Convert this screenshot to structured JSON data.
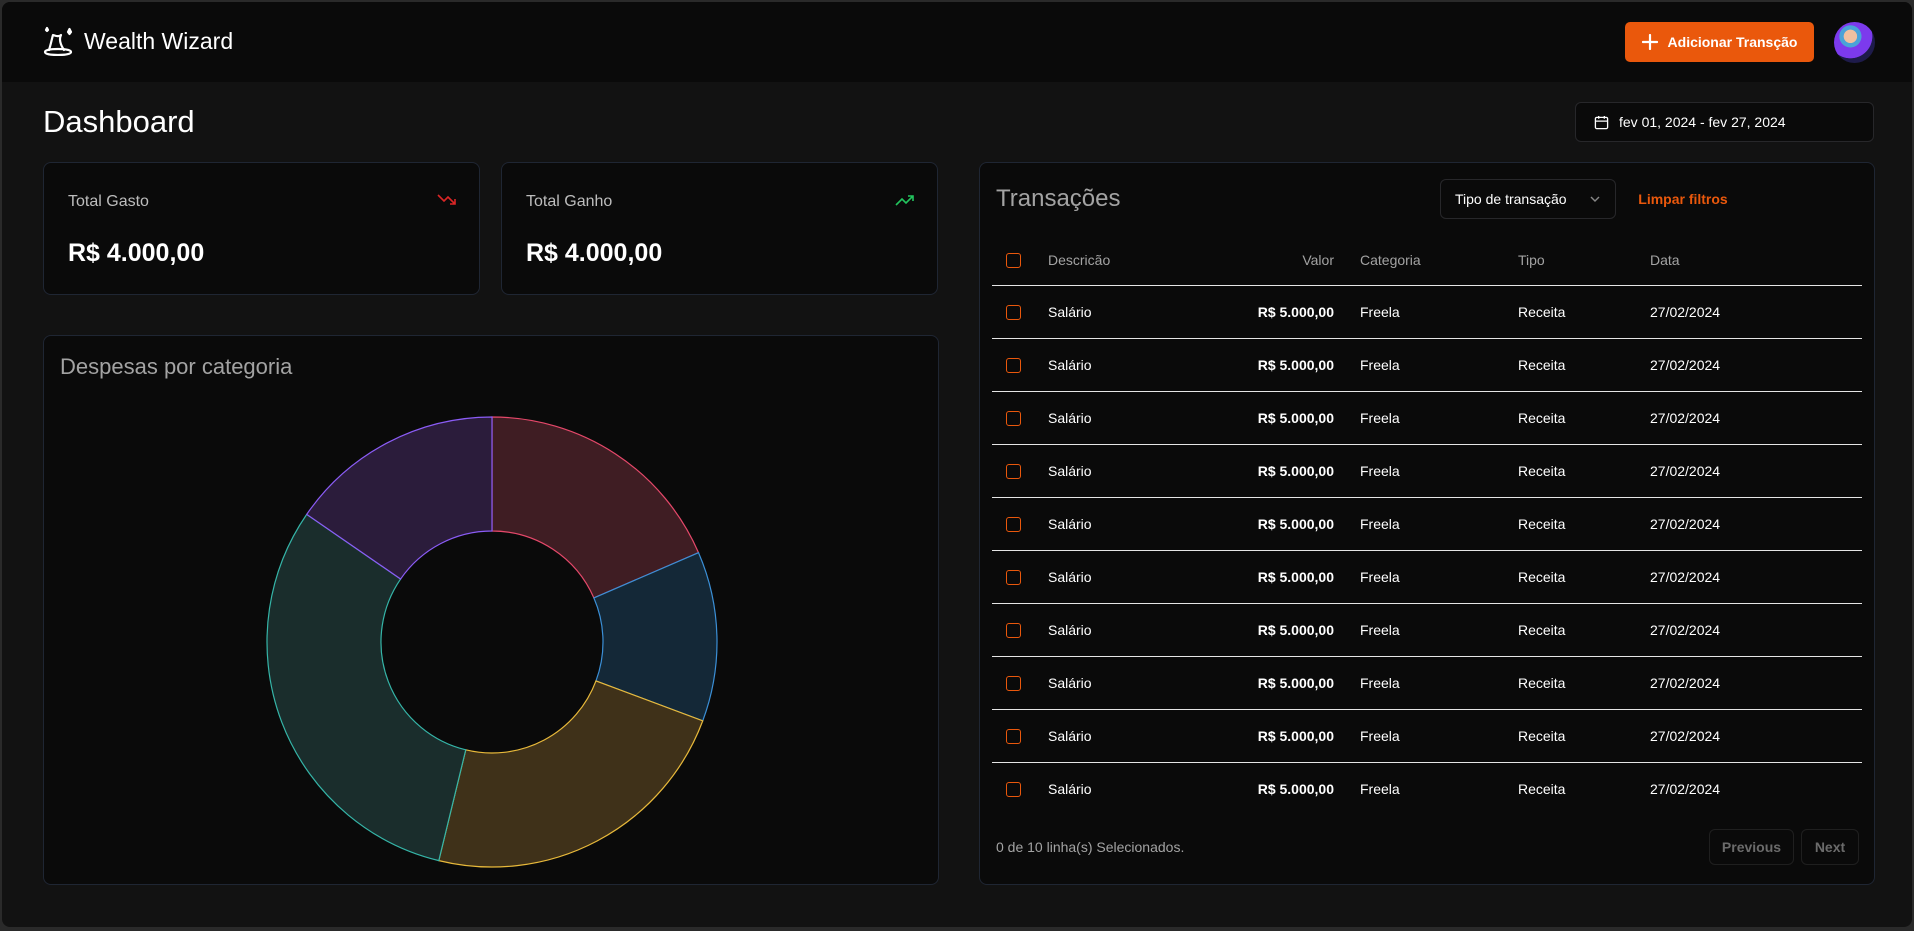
{
  "app": {
    "name": "Wealth Wizard",
    "logo_icon": "wizard-hat-icon"
  },
  "header": {
    "add_button": "Adicionar Transção",
    "avatar": "user-avatar"
  },
  "page": {
    "title": "Dashboard",
    "date_range": "fev 01, 2024 - fev 27, 2024"
  },
  "stats": [
    {
      "label": "Total Gasto",
      "value": "R$ 4.000,00",
      "icon": "trending-down-icon",
      "color": "#dc2626"
    },
    {
      "label": "Total Ganho",
      "value": "R$ 4.000,00",
      "icon": "trending-up-icon",
      "color": "#22c55e"
    }
  ],
  "chart": {
    "title": "Despesas por categoria"
  },
  "chart_data": {
    "type": "pie",
    "donut": true,
    "values": [
      18.5,
      12.2,
      23.1,
      30.8,
      15.4
    ],
    "colors": [
      {
        "stroke": "#e5486a",
        "fill": "#3f1d23"
      },
      {
        "stroke": "#3b8fd6",
        "fill": "#142837"
      },
      {
        "stroke": "#e8b93a",
        "fill": "#3f3119"
      },
      {
        "stroke": "#35b5a8",
        "fill": "#1a2d2c"
      },
      {
        "stroke": "#8b5cf6",
        "fill": "#2b1c3b"
      }
    ]
  },
  "transactions": {
    "title": "Transações",
    "filter_select": "Tipo de transação",
    "clear_filters": "Limpar filtros",
    "columns": [
      "Descricão",
      "Valor",
      "Categoria",
      "Tipo",
      "Data"
    ],
    "rows": [
      [
        "Salário",
        "R$ 5.000,00",
        "Freela",
        "Receita",
        "27/02/2024"
      ],
      [
        "Salário",
        "R$ 5.000,00",
        "Freela",
        "Receita",
        "27/02/2024"
      ],
      [
        "Salário",
        "R$ 5.000,00",
        "Freela",
        "Receita",
        "27/02/2024"
      ],
      [
        "Salário",
        "R$ 5.000,00",
        "Freela",
        "Receita",
        "27/02/2024"
      ],
      [
        "Salário",
        "R$ 5.000,00",
        "Freela",
        "Receita",
        "27/02/2024"
      ],
      [
        "Salário",
        "R$ 5.000,00",
        "Freela",
        "Receita",
        "27/02/2024"
      ],
      [
        "Salário",
        "R$ 5.000,00",
        "Freela",
        "Receita",
        "27/02/2024"
      ],
      [
        "Salário",
        "R$ 5.000,00",
        "Freela",
        "Receita",
        "27/02/2024"
      ],
      [
        "Salário",
        "R$ 5.000,00",
        "Freela",
        "Receita",
        "27/02/2024"
      ],
      [
        "Salário",
        "R$ 5.000,00",
        "Freela",
        "Receita",
        "27/02/2024"
      ]
    ],
    "selection_status": "0 de 10 linha(s) Selecionados.",
    "previous": "Previous",
    "next": "Next",
    "accent": "#ea580c"
  }
}
